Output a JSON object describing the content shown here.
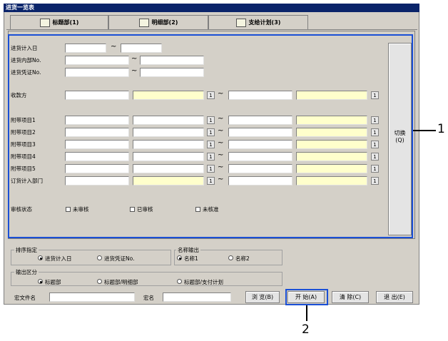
{
  "window": {
    "title": "进货一览表"
  },
  "tabs": [
    {
      "label": "标题部(1)",
      "icon": "book-icon"
    },
    {
      "label": "明细部(2)",
      "icon": "document-icon"
    },
    {
      "label": "支给计划(3)",
      "icon": "chart-icon"
    }
  ],
  "form": {
    "rows": {
      "arrival_date": "进货计入日",
      "internal_no": "进货内部No.",
      "voucher_no": "进货凭证No.",
      "receiver": "收款方",
      "extra1": "附带项目1",
      "extra2": "附带项目2",
      "extra3": "附带项目3",
      "extra4": "附带项目4",
      "extra5": "附带项目5",
      "order_dept": "订货计入部门",
      "review_status": "审核状态"
    },
    "tilde": "~",
    "select_btn": "1",
    "review_options": [
      "未审核",
      "已审核",
      "未核准"
    ],
    "toggle_button": "切换",
    "toggle_shortcut": "(Q)"
  },
  "sort": {
    "title": "排序指定",
    "options": [
      "进货计入日",
      "进货凭证No."
    ],
    "selected": "进货计入日"
  },
  "name_output": {
    "title": "名称输出",
    "options": [
      "名称1",
      "名称2"
    ],
    "selected": "名称1"
  },
  "output_section": {
    "title": "输出区分",
    "options": [
      "标题部",
      "标题部/明细部",
      "标题部/支付计划"
    ],
    "selected": "标题部"
  },
  "bottom": {
    "macro_file_label": "宏文件名",
    "macro_name_label": "宏名",
    "browse_button": "浏 览(B)",
    "start_button": "开 始(A)",
    "clear_button": "清 除(C)",
    "exit_button": "退 出(E)"
  },
  "callouts": {
    "one": "1",
    "two": "2"
  },
  "colors": {
    "highlight": "#1a4fd6",
    "title_bar": "#0a246a",
    "yellow_field": "#ffffcc"
  }
}
